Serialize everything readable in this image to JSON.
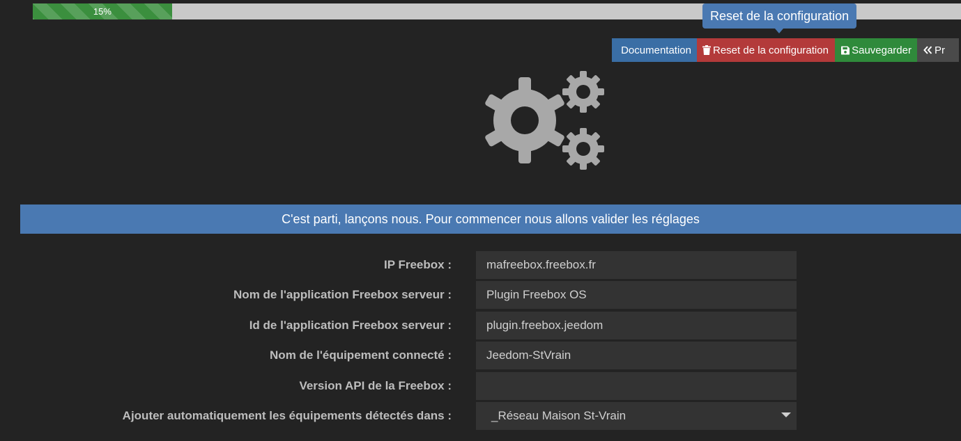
{
  "progress": {
    "label": "15%",
    "value": 0.15
  },
  "tooltip": {
    "text": "Reset de la configuration"
  },
  "toolbar": {
    "documentation_label": "Documentation",
    "reset_label": "Reset de la configuration",
    "save_label": "Sauvegarder",
    "previous_label": "Pr"
  },
  "banner": {
    "text": "C'est parti, lançons nous. Pour commencer nous allons valider les réglages"
  },
  "form": {
    "ip": {
      "label": "IP Freebox :",
      "value": "mafreebox.freebox.fr"
    },
    "app_name": {
      "label": "Nom de l'application Freebox serveur :",
      "value": "Plugin Freebox OS"
    },
    "app_id": {
      "label": "Id de l'application Freebox serveur :",
      "value": "plugin.freebox.jeedom"
    },
    "device_name": {
      "label": "Nom de l'équipement connecté :",
      "value": "Jeedom-StVrain"
    },
    "api_version": {
      "label": "Version API de la Freebox :",
      "value": ""
    },
    "auto_add": {
      "label": "Ajouter automatiquement les équipements détectés dans :",
      "value": "_Réseau Maison St-Vrain"
    }
  },
  "colors": {
    "background": "#232323",
    "primary": "#4a79b2",
    "documentation": "#3a6ea5",
    "reset": "#b33a3a",
    "save": "#2f8a3b",
    "previous": "#4a4a4a",
    "progress_fill": "#3b8f3e",
    "progress_track": "#c9c9c9",
    "gears": "#a8a8a8"
  },
  "icons": {
    "documentation": "book-icon",
    "reset": "trash-icon",
    "save": "floppy-icon",
    "previous": "double-chevron-left-icon",
    "header_illustration": "gears-icon",
    "select": "caret-down-icon"
  }
}
